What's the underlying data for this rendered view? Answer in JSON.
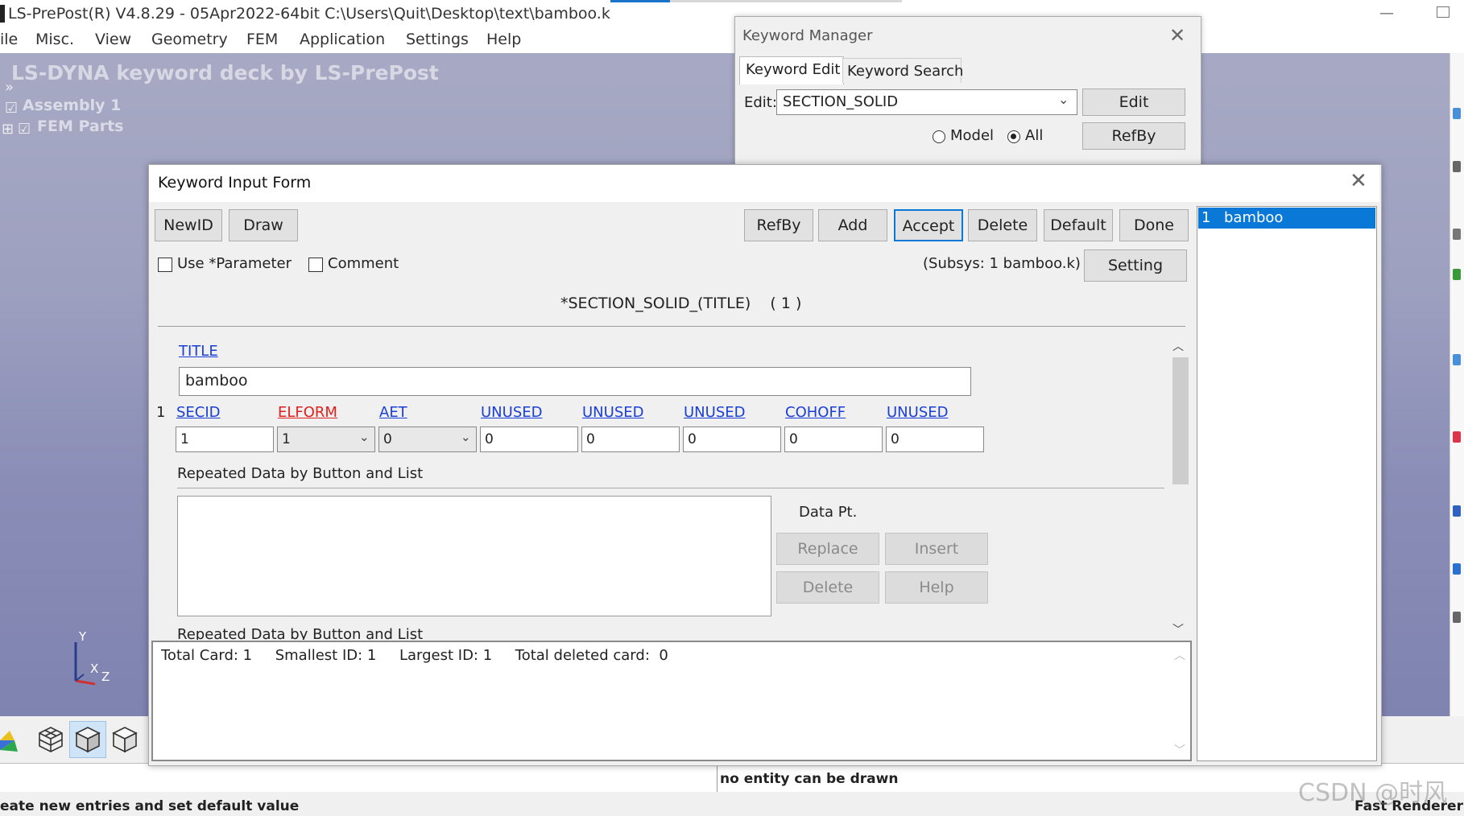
{
  "app": {
    "title": "LS-PrePost(R) V4.8.29 - 05Apr2022-64bit C:\\Users\\Quit\\Desktop\\text\\bamboo.k",
    "minimize_glyph": "—"
  },
  "menubar": [
    "ile",
    "Misc.",
    "View",
    "Geometry",
    "FEM",
    "Application",
    "Settings",
    "Help"
  ],
  "viewport": {
    "deck_title": "LS-DYNA keyword deck by LS-PrePost",
    "tree": {
      "expand_glyph": "»",
      "assembly": "Assembly 1",
      "parts": "FEM Parts"
    },
    "axis": {
      "y": "Y",
      "x": "X",
      "z": "Z"
    }
  },
  "bottom_toolbar": {
    "icons": [
      "fringe-plot-icon",
      "wireframe-cube-icon",
      "shaded-cube-icon",
      "outline-cube-icon"
    ],
    "active": "shaded-cube-icon"
  },
  "status": {
    "message": "no entity can be drawn",
    "hint": "eate new entries and set default value",
    "renderer": "Fast Renderer",
    "watermark": "CSDN @时风"
  },
  "keyword_manager": {
    "title": "Keyword Manager",
    "tabs": [
      "Keyword Edit",
      "Keyword Search"
    ],
    "active_tab": "Keyword Edit",
    "edit_label": "Edit:",
    "edit_value": "SECTION_SOLID",
    "edit_button": "Edit",
    "refby_button": "RefBy",
    "radio_model": "Model",
    "radio_all": "All",
    "selected_radio": "All"
  },
  "keyword_input_form": {
    "title": "Keyword Input Form",
    "buttons_left": [
      "NewID",
      "Draw"
    ],
    "buttons_right": [
      "RefBy",
      "Add",
      "Accept",
      "Delete",
      "Default",
      "Done"
    ],
    "default_button": "Accept",
    "use_parameter_label": "Use *Parameter",
    "comment_label": "Comment",
    "subsys": "(Subsys: 1 bamboo.k)",
    "setting_button": "Setting",
    "keyword_header": "*SECTION_SOLID_(TITLE)    ( 1 )",
    "title_label": "TITLE",
    "title_value": "bamboo",
    "card_number": "1",
    "fields": [
      {
        "label": "SECID",
        "value": "1",
        "kind": "input",
        "color": "blue"
      },
      {
        "label": "ELFORM",
        "value": "1",
        "kind": "select",
        "color": "red"
      },
      {
        "label": "AET",
        "value": "0",
        "kind": "select",
        "color": "blue"
      },
      {
        "label": "UNUSED",
        "value": "0",
        "kind": "input",
        "color": "blue"
      },
      {
        "label": "UNUSED",
        "value": "0",
        "kind": "input",
        "color": "blue"
      },
      {
        "label": "UNUSED",
        "value": "0",
        "kind": "input",
        "color": "blue"
      },
      {
        "label": "COHOFF",
        "value": "0",
        "kind": "input",
        "color": "blue"
      },
      {
        "label": "UNUSED",
        "value": "0",
        "kind": "input",
        "color": "blue"
      }
    ],
    "repeated_label": "Repeated Data by Button and List",
    "data_pt_label": "Data Pt.",
    "data_buttons": [
      "Replace",
      "Insert",
      "Delete",
      "Help"
    ],
    "summary": "Total Card: 1     Smallest ID: 1     Largest ID: 1     Total deleted card:  0",
    "id_list": [
      {
        "id": "1",
        "name": "bamboo"
      }
    ]
  },
  "colors": {
    "accent": "#0a78d7",
    "link_blue": "#1a3fd6",
    "required_red": "#e0201c",
    "viewport_top": "#a7a9c4",
    "viewport_bottom": "#7f83b0"
  }
}
